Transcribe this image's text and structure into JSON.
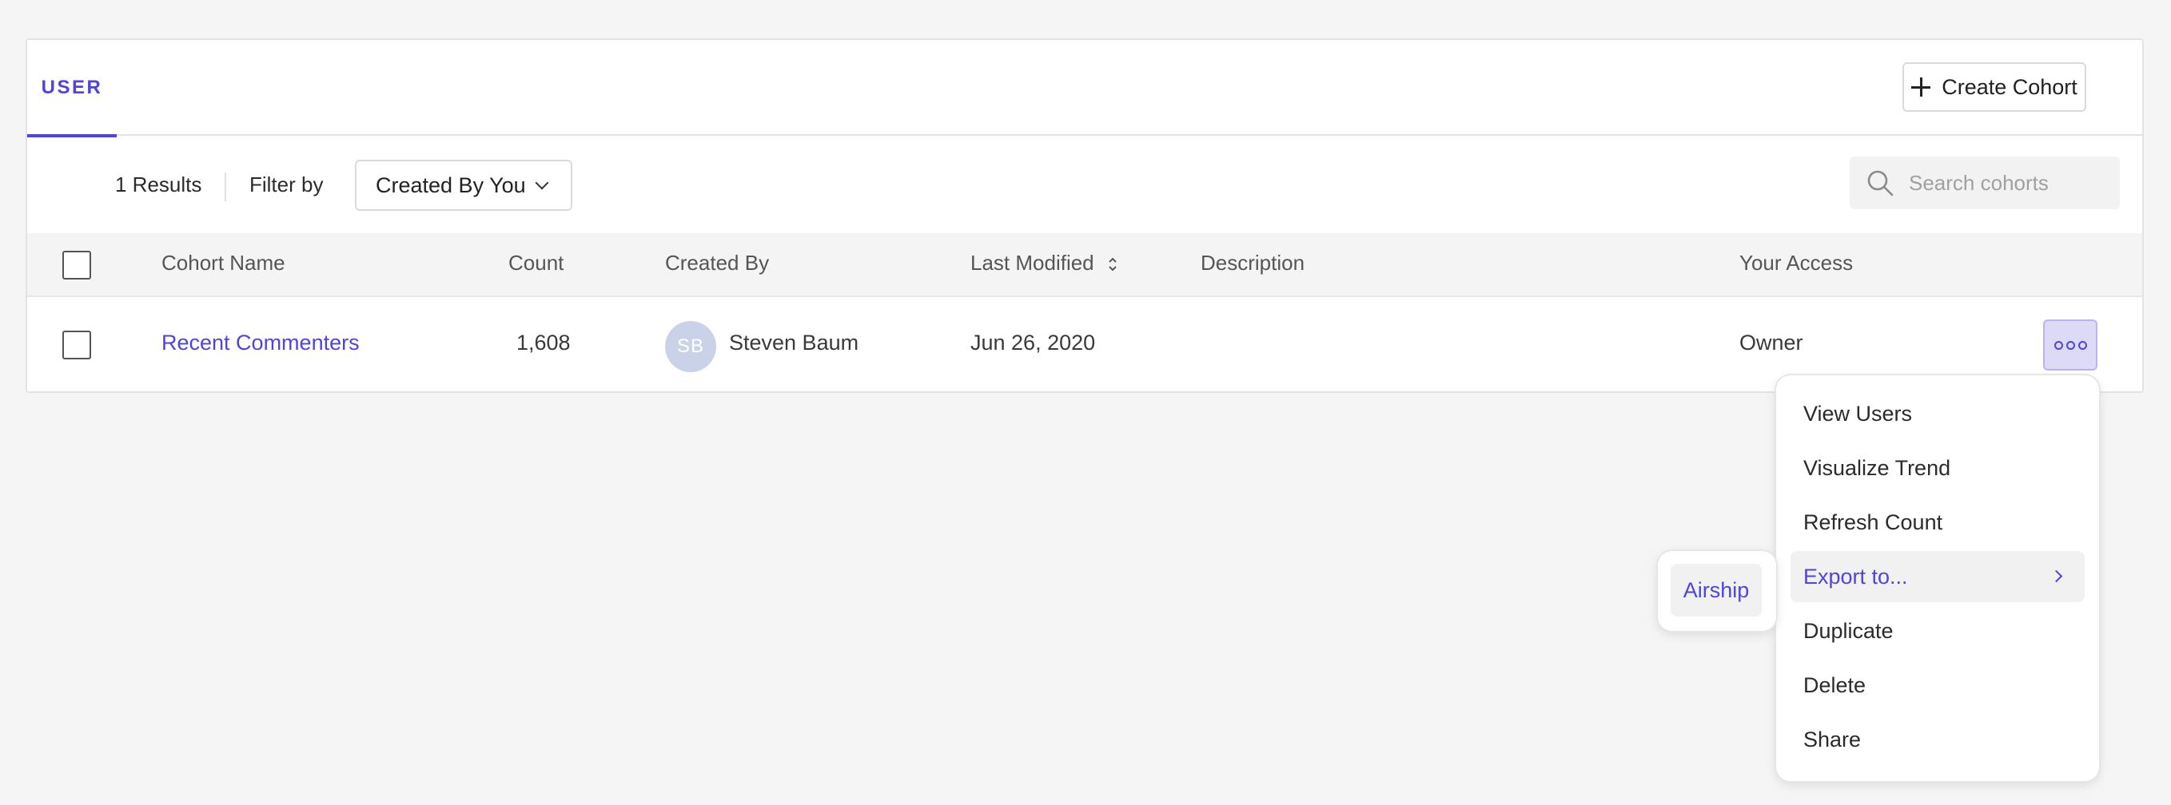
{
  "tabs": [
    {
      "label": "USER",
      "active": true
    }
  ],
  "toolbar": {
    "create_label": "Create Cohort"
  },
  "filters": {
    "results_text": "1 Results",
    "filter_by_label": "Filter by",
    "filter_value": "Created By You",
    "search_placeholder": "Search cohorts"
  },
  "table": {
    "columns": [
      "Cohort Name",
      "Count",
      "Created By",
      "Last Modified",
      "Description",
      "Your Access"
    ],
    "rows": [
      {
        "name": "Recent Commenters",
        "count": "1,608",
        "creator_initials": "SB",
        "creator_name": "Steven Baum",
        "last_modified": "Jun 26, 2020",
        "description": "",
        "access": "Owner"
      }
    ]
  },
  "menu": {
    "items": [
      "View Users",
      "Visualize Trend",
      "Refresh Count",
      "Export to...",
      "Duplicate",
      "Delete",
      "Share"
    ],
    "active_index": 3,
    "submenu": [
      "Airship"
    ]
  },
  "colors": {
    "accent": "#4f44e0",
    "avatar": "#c9d2e8",
    "header_bg": "#f4f4f4"
  },
  "icons": [
    "plus-icon",
    "chevron-down-icon",
    "search-icon",
    "sort-icon",
    "more-icon",
    "chevron-right-icon"
  ]
}
